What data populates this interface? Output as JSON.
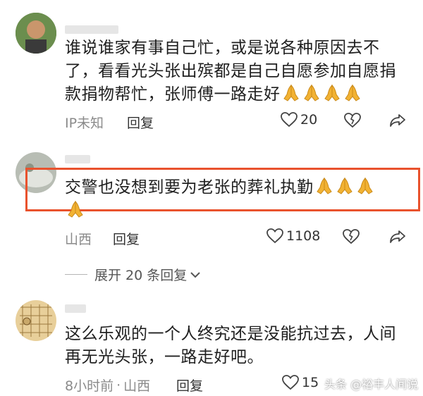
{
  "comments": [
    {
      "text_lines": [
        "谁说谁家有事自己忙，或是说各种原因去不",
        "了，看看光头张出殡都是自己自愿参加自愿捐",
        "款捐物帮忙，张师傅一路走好"
      ],
      "emoji_count": 4,
      "location": "IP未知",
      "reply_label": "回复",
      "likes": "20"
    },
    {
      "text_lines": [
        "交警也没想到要为老张的葬礼执勤"
      ],
      "emoji_count": 4,
      "location": "山西",
      "reply_label": "回复",
      "likes": "1108"
    },
    {
      "text_lines": [
        "这么乐观的一个人终究还是没能抗过去，人间",
        "再无光头张，一路走好吧。"
      ],
      "emoji_count": 0,
      "time": "8小时前",
      "dot": "·",
      "location": "山西",
      "reply_label": "回复",
      "likes": "15"
    }
  ],
  "expand_replies": "展开 20 条回复",
  "watermark": "头条 @裕丰人间说",
  "colors": {
    "highlight": "#e9522d",
    "emoji": "#f2b233"
  }
}
